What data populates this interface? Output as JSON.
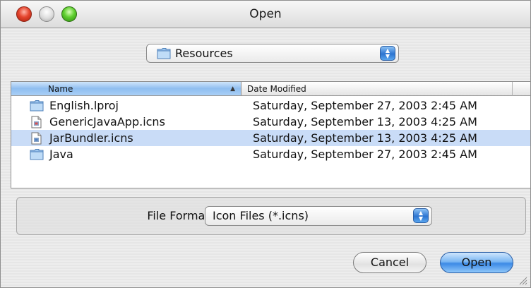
{
  "window": {
    "title": "Open"
  },
  "location": {
    "folder_icon": "folder-icon",
    "label": "Resources"
  },
  "browser": {
    "columns": {
      "name": "Name",
      "date": "Date Modified",
      "sort_indicator": "▲"
    },
    "rows": [
      {
        "name": "English.lproj",
        "date": "Saturday, September 27, 2003 2:45 AM",
        "icon": "folder-icon",
        "selected": false
      },
      {
        "name": "GenericJavaApp.icns",
        "date": "Saturday, September 13, 2003 4:25 AM",
        "icon": "document-icon",
        "selected": false
      },
      {
        "name": "JarBundler.icns",
        "date": "Saturday, September 13, 2003 4:25 AM",
        "icon": "document-icon",
        "selected": true
      },
      {
        "name": "Java",
        "date": "Saturday, September 27, 2003 2:45 AM",
        "icon": "folder-icon",
        "selected": false
      }
    ],
    "selection_color": "#c9dcf7",
    "header_active_color": "#8fbef0"
  },
  "format": {
    "label": "File Format:",
    "selected": "Icon Files (*.icns)"
  },
  "buttons": {
    "cancel": "Cancel",
    "open": "Open"
  }
}
